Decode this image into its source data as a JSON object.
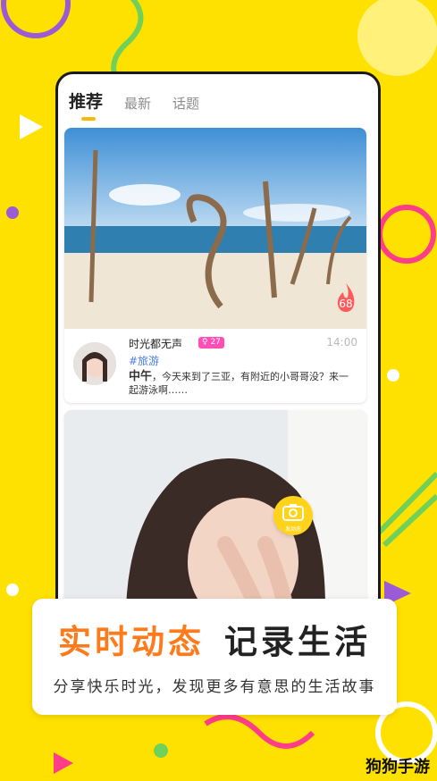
{
  "tabs": [
    "推荐",
    "最新",
    "话题"
  ],
  "post": {
    "username": "时光都无声",
    "badge": "♀ 27",
    "time": "14:00",
    "topic": "#旅游",
    "time_of_day": "中午",
    "text": "，今天来到了三亚，有附近的小哥哥没？来一起游泳啊……",
    "heat_count": "68"
  },
  "camera_caption": "发动态",
  "banner": {
    "headline_1": "实时动态",
    "headline_2": "记录生活",
    "subline": "分享快乐时光，发现更多有意思的生活故事"
  },
  "watermark": "狗狗手游",
  "colors": {
    "background": "#FFE100",
    "accent_orange": "#ff7a1a",
    "badge_pink": "#ff4fb6",
    "topic_blue": "#4a7ee8",
    "camera_yellow": "#ffd31a"
  }
}
